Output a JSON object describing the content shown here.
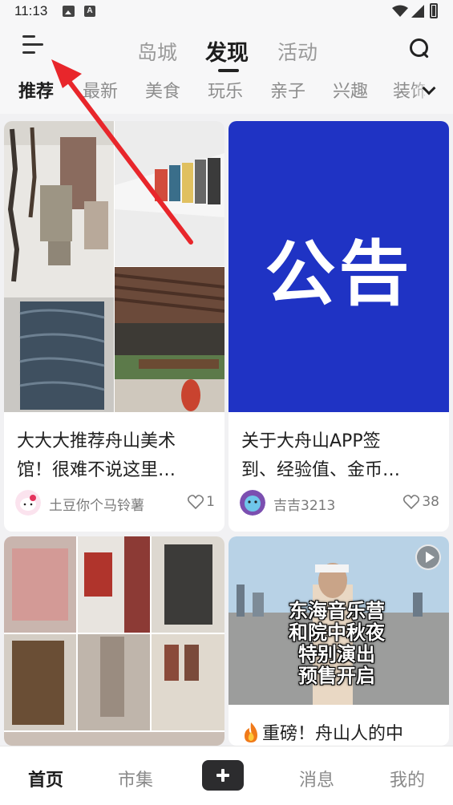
{
  "status_bar": {
    "time": "11:13",
    "notification_icons": [
      "image-icon",
      "a-icon"
    ],
    "system_icons": [
      "wifi-icon",
      "signal-icon",
      "battery-icon"
    ]
  },
  "header": {
    "menu_icon": "menu-icon",
    "top_tabs": [
      {
        "label": "岛城",
        "active": false
      },
      {
        "label": "发现",
        "active": true
      },
      {
        "label": "活动",
        "active": false
      }
    ],
    "search_icon": "search-icon",
    "categories": [
      {
        "label": "推荐",
        "active": true
      },
      {
        "label": "最新",
        "active": false
      },
      {
        "label": "美食",
        "active": false
      },
      {
        "label": "玩乐",
        "active": false
      },
      {
        "label": "亲子",
        "active": false
      },
      {
        "label": "兴趣",
        "active": false
      },
      {
        "label": "装饰",
        "active": false
      }
    ],
    "expand_icon": "chevron-down-icon"
  },
  "feed": [
    {
      "title": "大大大推荐舟山美术馆！很难不说这里…",
      "title_line1": "大大大推荐舟山美术",
      "title_line2": "馆！很难不说这里…",
      "author": "土豆你个马铃薯",
      "likes": "1",
      "media": "photo-collage"
    },
    {
      "title": "关于大舟山APP签到、经验值、金币…",
      "title_line1": "关于大舟山APP签",
      "title_line2": "到、经验值、金币…",
      "cover_text": "公告",
      "author": "吉吉3213",
      "likes": "38",
      "media": "notice-cover"
    },
    {
      "title_line1": "",
      "media": "photo-collage"
    },
    {
      "title_line1": "重磅！舟山人的中",
      "caption_lines": [
        "东海音乐营",
        "和院中秋夜",
        "特别演出",
        "预售开启"
      ],
      "media": "video",
      "badge_icon": "fire-icon"
    }
  ],
  "bottom_nav": {
    "items": [
      {
        "label": "首页",
        "active": true
      },
      {
        "label": "市集",
        "active": false
      },
      {
        "label": "消息",
        "active": false
      },
      {
        "label": "我的",
        "active": false
      }
    ],
    "plus_icon": "plus-icon"
  },
  "colors": {
    "notice_blue": "#1f33c4",
    "annotation_red": "#e8262b",
    "active_text": "#1d1d1d",
    "inactive_text": "#8d8d8d"
  }
}
